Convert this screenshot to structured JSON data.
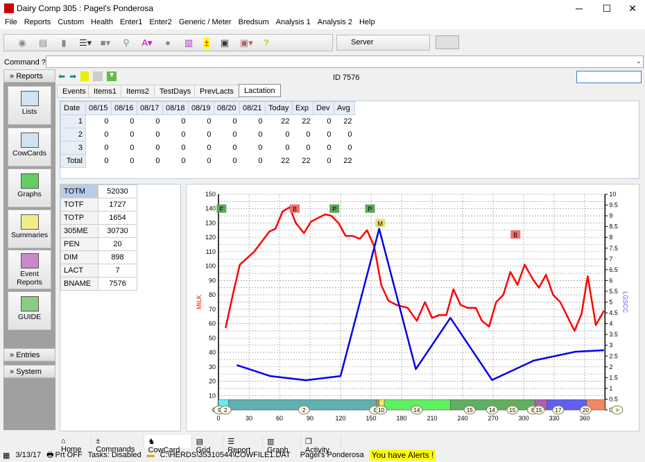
{
  "window": {
    "title": "Dairy Comp 305 : Pagel's Ponderosa"
  },
  "menu": [
    "File",
    "Reports",
    "Custom",
    "Health",
    "Enter1",
    "Enter2",
    "Generic / Meter",
    "Bredsum",
    "Analysis 1",
    "Analysis 2",
    "Help"
  ],
  "toolbar": {
    "server_label": "Server",
    "icons": [
      "back-icon",
      "print-icon",
      "document-icon",
      "list-icon",
      "folder-icon",
      "search-icon",
      "font-icon",
      "cows-icon",
      "chart-icon",
      "plus-minus-icon",
      "book-icon",
      "safe-icon",
      "help-icon"
    ]
  },
  "command": {
    "label": "Command ?",
    "value": ""
  },
  "sidebar": {
    "header": "Reports",
    "items": [
      {
        "label": "Lists"
      },
      {
        "label": "CowCards"
      },
      {
        "label": "Graphs"
      },
      {
        "label": "Summaries"
      },
      {
        "label": "Event Reports"
      },
      {
        "label": "GUIDE"
      }
    ],
    "entries": "Entries",
    "system": "System"
  },
  "cow": {
    "id_label": "ID 7576",
    "search_value": ""
  },
  "tabs": [
    "Events",
    "Items1",
    "Items2",
    "TestDays",
    "PrevLacts",
    "Lactation"
  ],
  "active_tab": "Lactation",
  "grid": {
    "headers": [
      "Date",
      "08/15",
      "08/16",
      "08/17",
      "08/18",
      "08/19",
      "08/20",
      "08/21",
      "Today",
      "Exp",
      "Dev",
      "Avg"
    ],
    "rows": [
      [
        "1",
        "0",
        "0",
        "0",
        "0",
        "0",
        "0",
        "0",
        "22",
        "22",
        "0",
        "22"
      ],
      [
        "2",
        "0",
        "0",
        "0",
        "0",
        "0",
        "0",
        "0",
        "0",
        "0",
        "0",
        "0"
      ],
      [
        "3",
        "0",
        "0",
        "0",
        "0",
        "0",
        "0",
        "0",
        "0",
        "0",
        "0",
        "0"
      ],
      [
        "Total",
        "0",
        "0",
        "0",
        "0",
        "0",
        "0",
        "0",
        "22",
        "22",
        "0",
        "22"
      ]
    ]
  },
  "stats": [
    [
      "TOTM",
      "52030"
    ],
    [
      "TOTF",
      "1727"
    ],
    [
      "TOTP",
      "1654"
    ],
    [
      "305ME",
      "30730"
    ],
    [
      "PEN",
      "20"
    ],
    [
      "DIM",
      "898"
    ],
    [
      "LACT",
      "7"
    ],
    [
      "BNAME",
      "7576"
    ]
  ],
  "chart_data": {
    "type": "line",
    "xlabel": "",
    "ylabel": "MILK",
    "y2label": "LGSCC",
    "xlim": [
      0,
      380
    ],
    "ylim": [
      0,
      150
    ],
    "y2lim": [
      0,
      10
    ],
    "grid": true,
    "xticks": [
      0,
      30,
      60,
      90,
      120,
      150,
      180,
      210,
      240,
      270,
      300,
      330,
      360
    ],
    "yticks": [
      0,
      10,
      20,
      30,
      40,
      50,
      60,
      70,
      80,
      90,
      100,
      110,
      120,
      130,
      140,
      150
    ],
    "y2ticks": [
      "0",
      "0.5",
      "1",
      "1.5",
      "2",
      "2.5",
      "3",
      "3.5",
      "4",
      "4.5",
      "5",
      "5.5",
      "6",
      "6.5",
      "7",
      "7.5",
      "8",
      "8.5",
      "9",
      "9.5",
      "10"
    ],
    "series": [
      {
        "name": "MILK",
        "axis": "left",
        "color": "#ff0000",
        "x": [
          7,
          15,
          21,
          35,
          50,
          56,
          63,
          70,
          76,
          84,
          91,
          105,
          111,
          118,
          125,
          132,
          139,
          146,
          153,
          160,
          167,
          175,
          186,
          195,
          203,
          210,
          217,
          224,
          231,
          238,
          245,
          253,
          259,
          266,
          273,
          280,
          287,
          294,
          301,
          309,
          315,
          322,
          329,
          336,
          343,
          350,
          357,
          363,
          371,
          379
        ],
        "y": [
          57,
          83,
          101,
          110,
          124,
          126,
          138,
          141,
          130,
          123,
          131,
          136,
          135,
          130,
          121,
          121,
          119,
          125,
          114,
          87,
          76,
          73,
          71,
          62,
          75,
          64,
          66,
          66,
          84,
          73,
          71,
          71,
          62,
          58,
          75,
          80,
          96,
          87,
          101,
          91,
          85,
          94,
          80,
          75,
          65,
          55,
          67,
          93,
          59,
          69
        ]
      },
      {
        "name": "LGSCC",
        "axis": "right",
        "color": "#0000ee",
        "x": [
          18,
          51,
          86,
          120,
          158,
          194,
          228,
          269,
          310,
          351,
          379
        ],
        "y": [
          2.08,
          1.57,
          1.38,
          1.57,
          8.4,
          1.89,
          4.27,
          1.39,
          2.29,
          2.7,
          2.77
        ]
      }
    ],
    "events": [
      {
        "label": "F",
        "x": 3,
        "y": 140,
        "color": "#5aa65a"
      },
      {
        "label": "B",
        "x": 75,
        "y": 140,
        "color": "#f07070"
      },
      {
        "label": "P",
        "x": 114,
        "y": 140,
        "color": "#5aa65a"
      },
      {
        "label": "P",
        "x": 149,
        "y": 140,
        "color": "#5aa65a"
      },
      {
        "label": "M",
        "x": 159,
        "y": 130,
        "color": "#e8e070"
      },
      {
        "label": "B",
        "x": 292,
        "y": 122,
        "color": "#f07070"
      }
    ],
    "pen_bands": [
      {
        "from": 0,
        "to": 10,
        "color": "#60f0f0"
      },
      {
        "from": 10,
        "to": 155,
        "color": "#60b0b0"
      },
      {
        "from": 155,
        "to": 158,
        "color": "#a0a060"
      },
      {
        "from": 158,
        "to": 163,
        "color": "#f0f060"
      },
      {
        "from": 163,
        "to": 228,
        "color": "#60f060"
      },
      {
        "from": 228,
        "to": 311,
        "color": "#60b060"
      },
      {
        "from": 311,
        "to": 323,
        "color": "#b060b0"
      },
      {
        "from": 323,
        "to": 362,
        "color": "#6060f0"
      },
      {
        "from": 362,
        "to": 380,
        "color": "#f08860"
      }
    ],
    "pen_labels": [
      {
        "x": 1,
        "label": "9"
      },
      {
        "x": 7,
        "label": "2"
      },
      {
        "x": 84,
        "label": "2"
      },
      {
        "x": 154,
        "label": "0"
      },
      {
        "x": 160,
        "label": "10"
      },
      {
        "x": 195,
        "label": "14"
      },
      {
        "x": 247,
        "label": "15"
      },
      {
        "x": 269,
        "label": "14"
      },
      {
        "x": 289,
        "label": "15"
      },
      {
        "x": 309,
        "label": "8"
      },
      {
        "x": 315,
        "label": "15"
      },
      {
        "x": 334,
        "label": "17"
      },
      {
        "x": 361,
        "label": "20"
      },
      {
        "x": 392,
        "label": ">"
      }
    ]
  },
  "bottom_tabs": [
    "Home",
    "Commands",
    "CowCard",
    "Grid",
    "Report",
    "Graph",
    "Activity"
  ],
  "active_bottom_tab": "CowCard",
  "status": {
    "date": "3/13/17",
    "printer": "Prt OFF",
    "tasks": "Tasks: Disabled",
    "path": "C:\\HERDS\\35310544\\COWFILE1.DAT",
    "herd": "Pagel's Ponderosa",
    "alert": "You have Alerts !"
  }
}
